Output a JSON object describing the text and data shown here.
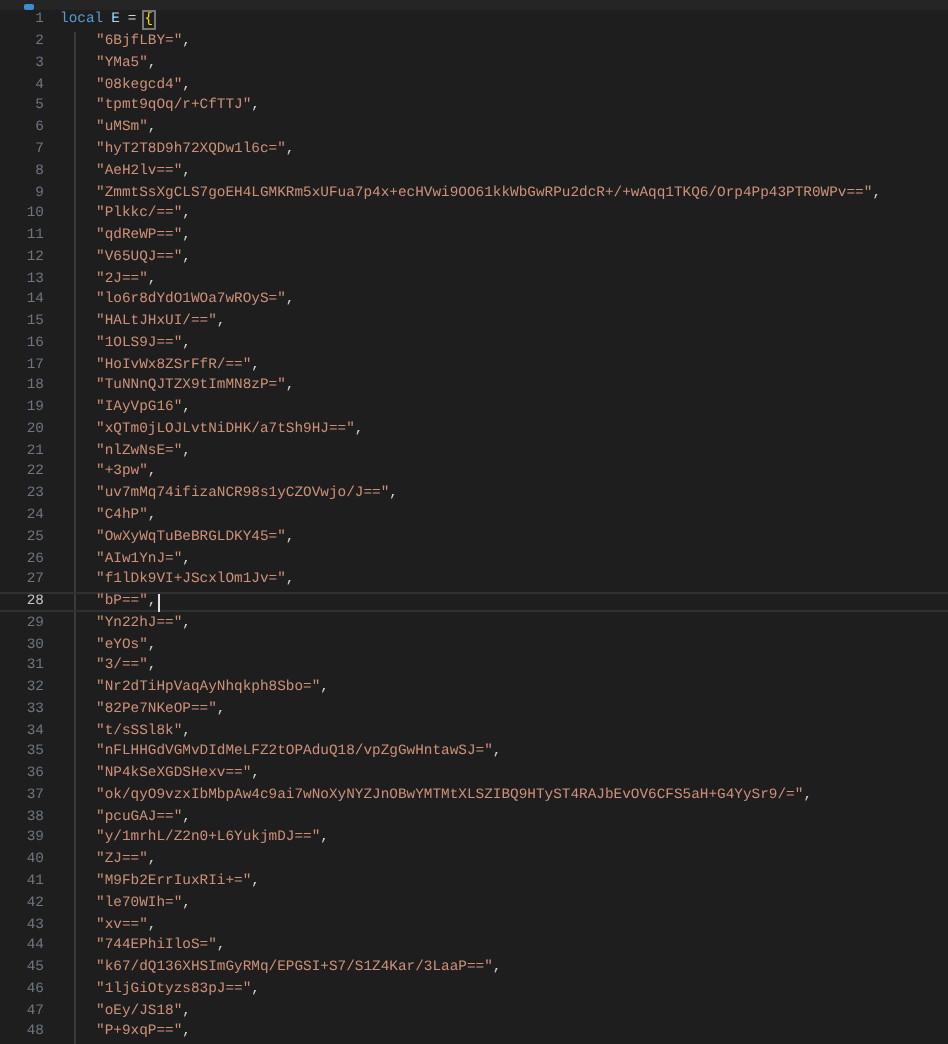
{
  "header_line": {
    "number": "1",
    "keyword": "local",
    "name": "E",
    "operator": "=",
    "bracket": "{"
  },
  "entries": [
    {
      "number": "2",
      "string": "\"6BjfLBY=\"",
      "punct": ",",
      "current": false
    },
    {
      "number": "3",
      "string": "\"YMa5\"",
      "punct": ",",
      "current": false
    },
    {
      "number": "4",
      "string": "\"08kegcd4\"",
      "punct": ",",
      "current": false
    },
    {
      "number": "5",
      "string": "\"tpmt9qOq/r+CfTTJ\"",
      "punct": ",",
      "current": false
    },
    {
      "number": "6",
      "string": "\"uMSm\"",
      "punct": ",",
      "current": false
    },
    {
      "number": "7",
      "string": "\"hyT2T8D9h72XQDw1l6c=\"",
      "punct": ",",
      "current": false
    },
    {
      "number": "8",
      "string": "\"AeH2lv==\"",
      "punct": ",",
      "current": false
    },
    {
      "number": "9",
      "string": "\"ZmmtSsXgCLS7goEH4LGMKRm5xUFua7p4x+ecHVwi9OO61kkWbGwRPu2dcR+/+wAqq1TKQ6/Orp4Pp43PTR0WPv==\"",
      "punct": ",",
      "current": false
    },
    {
      "number": "10",
      "string": "\"Plkkc/==\"",
      "punct": ",",
      "current": false
    },
    {
      "number": "11",
      "string": "\"qdReWP==\"",
      "punct": ",",
      "current": false
    },
    {
      "number": "12",
      "string": "\"V65UQJ==\"",
      "punct": ",",
      "current": false
    },
    {
      "number": "13",
      "string": "\"2J==\"",
      "punct": ",",
      "current": false
    },
    {
      "number": "14",
      "string": "\"lo6r8dYdO1WOa7wROyS=\"",
      "punct": ",",
      "current": false
    },
    {
      "number": "15",
      "string": "\"HALtJHxUI/==\"",
      "punct": ",",
      "current": false
    },
    {
      "number": "16",
      "string": "\"1OLS9J==\"",
      "punct": ",",
      "current": false
    },
    {
      "number": "17",
      "string": "\"HoIvWx8ZSrFfR/==\"",
      "punct": ",",
      "current": false
    },
    {
      "number": "18",
      "string": "\"TuNNnQJTZX9tImMN8zP=\"",
      "punct": ",",
      "current": false
    },
    {
      "number": "19",
      "string": "\"IAyVpG16\"",
      "punct": ",",
      "current": false
    },
    {
      "number": "20",
      "string": "\"xQTm0jLOJLvtNiDHK/a7tSh9HJ==\"",
      "punct": ",",
      "current": false
    },
    {
      "number": "21",
      "string": "\"nlZwNsE=\"",
      "punct": ",",
      "current": false
    },
    {
      "number": "22",
      "string": "\"+3pw\"",
      "punct": ",",
      "current": false
    },
    {
      "number": "23",
      "string": "\"uv7mMq74ifizaNCR98s1yCZOVwjo/J==\"",
      "punct": ",",
      "current": false
    },
    {
      "number": "24",
      "string": "\"C4hP\"",
      "punct": ",",
      "current": false
    },
    {
      "number": "25",
      "string": "\"OwXyWqTuBeBRGLDKY45=\"",
      "punct": ",",
      "current": false
    },
    {
      "number": "26",
      "string": "\"AIw1YnJ=\"",
      "punct": ",",
      "current": false
    },
    {
      "number": "27",
      "string": "\"f1lDk9VI+JScxlOm1Jv=\"",
      "punct": ",",
      "current": false
    },
    {
      "number": "28",
      "string": "\"bP==\"",
      "punct": ",",
      "current": true
    },
    {
      "number": "29",
      "string": "\"Yn22hJ==\"",
      "punct": ",",
      "current": false
    },
    {
      "number": "30",
      "string": "\"eYOs\"",
      "punct": ",",
      "current": false
    },
    {
      "number": "31",
      "string": "\"3/==\"",
      "punct": ",",
      "current": false
    },
    {
      "number": "32",
      "string": "\"Nr2dTiHpVaqAyNhqkph8Sbo=\"",
      "punct": ",",
      "current": false
    },
    {
      "number": "33",
      "string": "\"82Pe7NKeOP==\"",
      "punct": ",",
      "current": false
    },
    {
      "number": "34",
      "string": "\"t/sSSl8k\"",
      "punct": ",",
      "current": false
    },
    {
      "number": "35",
      "string": "\"nFLHHGdVGMvDIdMeLFZ2tOPAduQ18/vpZgGwHntawSJ=\"",
      "punct": ",",
      "current": false
    },
    {
      "number": "36",
      "string": "\"NP4kSeXGDSHexv==\"",
      "punct": ",",
      "current": false
    },
    {
      "number": "37",
      "string": "\"ok/qyO9vzxIbMbpAw4c9ai7wNoXyNYZJnOBwYMTMtXLSZIBQ9HTyST4RAJbEvOV6CFS5aH+G4YySr9/=\"",
      "punct": ",",
      "current": false
    },
    {
      "number": "38",
      "string": "\"pcuGAJ==\"",
      "punct": ",",
      "current": false
    },
    {
      "number": "39",
      "string": "\"y/1mrhL/Z2n0+L6YukjmDJ==\"",
      "punct": ",",
      "current": false
    },
    {
      "number": "40",
      "string": "\"ZJ==\"",
      "punct": ",",
      "current": false
    },
    {
      "number": "41",
      "string": "\"M9Fb2ErrIuxRIi+=\"",
      "punct": ",",
      "current": false
    },
    {
      "number": "42",
      "string": "\"le70WIh=\"",
      "punct": ",",
      "current": false
    },
    {
      "number": "43",
      "string": "\"xv==\"",
      "punct": ",",
      "current": false
    },
    {
      "number": "44",
      "string": "\"744EPhiIloS=\"",
      "punct": ",",
      "current": false
    },
    {
      "number": "45",
      "string": "\"k67/dQ136XHSImGyRMq/EPGSI+S7/S1Z4Kar/3LaaP==\"",
      "punct": ",",
      "current": false
    },
    {
      "number": "46",
      "string": "\"1ljGiOtyzs83pJ==\"",
      "punct": ",",
      "current": false
    },
    {
      "number": "47",
      "string": "\"oEy/JS18\"",
      "punct": ",",
      "current": false
    },
    {
      "number": "48",
      "string": "\"P+9xqP==\"",
      "punct": ",",
      "current": false
    }
  ]
}
